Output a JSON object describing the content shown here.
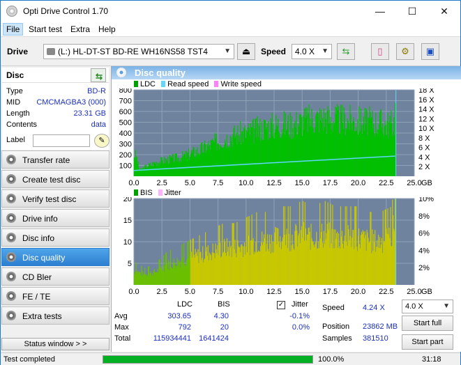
{
  "window": {
    "title": "Opti Drive Control 1.70",
    "minimize": "—",
    "maximize": "☐",
    "close": "✕"
  },
  "menu": [
    "File",
    "Start test",
    "Extra",
    "Help"
  ],
  "toolbar": {
    "drive_label": "Drive",
    "drive_value": "(L:)  HL-DT-ST BD-RE  WH16NS58 TST4",
    "speed_label": "Speed",
    "speed_value": "4.0 X",
    "icons": [
      "eject-icon",
      "refresh-icon",
      "eraser-icon",
      "settings-icon",
      "save-icon"
    ]
  },
  "disc": {
    "heading": "Disc",
    "rows": [
      {
        "k": "Type",
        "v": "BD-R"
      },
      {
        "k": "MID",
        "v": "CMCMAGBA3 (000)"
      },
      {
        "k": "Length",
        "v": "23.31 GB"
      },
      {
        "k": "Contents",
        "v": "data"
      }
    ],
    "label_text": "Label",
    "label_value": ""
  },
  "nav": [
    {
      "id": "transfer-rate",
      "label": "Transfer rate",
      "active": false
    },
    {
      "id": "create-test-disc",
      "label": "Create test disc",
      "active": false
    },
    {
      "id": "verify-test-disc",
      "label": "Verify test disc",
      "active": false
    },
    {
      "id": "drive-info",
      "label": "Drive info",
      "active": false
    },
    {
      "id": "disc-info",
      "label": "Disc info",
      "active": false
    },
    {
      "id": "disc-quality",
      "label": "Disc quality",
      "active": true
    },
    {
      "id": "cd-bler",
      "label": "CD Bler",
      "active": false
    },
    {
      "id": "fe-te",
      "label": "FE / TE",
      "active": false
    },
    {
      "id": "extra-tests",
      "label": "Extra tests",
      "active": false
    }
  ],
  "status_window_label": "Status window > >",
  "panel_title": "Disc quality",
  "legend_top": [
    "LDC",
    "Read speed",
    "Write speed"
  ],
  "legend_bottom": [
    "BIS",
    "Jitter"
  ],
  "colors": {
    "ldc": "#00c000",
    "read_speed": "#5fd7ff",
    "write_speed": "#ff7fff",
    "bis": "#c8c800",
    "jitter": "#ffb0ff",
    "grid": "#8fa2b8",
    "plot_bg": "#6f839e"
  },
  "chart_data": [
    {
      "type": "bar",
      "title": "",
      "xlabel": "GB",
      "x_ticks": [
        "0.0",
        "2.5",
        "5.0",
        "7.5",
        "10.0",
        "12.5",
        "15.0",
        "17.5",
        "20.0",
        "22.5",
        "25.0"
      ],
      "xlim": [
        0,
        25
      ],
      "y_left_ticks": [
        "100",
        "200",
        "300",
        "400",
        "500",
        "600",
        "700",
        "800"
      ],
      "ylim_left": [
        0,
        800
      ],
      "y_right_ticks": [
        "2 X",
        "4 X",
        "6 X",
        "8 X",
        "10 X",
        "12 X",
        "14 X",
        "16 X",
        "18 X"
      ],
      "ylim_right": [
        0,
        18
      ],
      "series": [
        {
          "name": "LDC",
          "x": [
            0.2,
            0.5,
            1,
            2,
            3,
            4,
            5,
            6,
            7,
            8,
            9,
            10,
            11,
            12,
            13,
            14,
            15,
            16,
            17,
            18,
            19,
            20,
            21,
            22,
            23,
            23.3
          ],
          "values": [
            250,
            70,
            110,
            170,
            200,
            220,
            270,
            320,
            390,
            450,
            500,
            520,
            560,
            600,
            620,
            620,
            660,
            690,
            700,
            680,
            670,
            660,
            650,
            640,
            620,
            680
          ]
        },
        {
          "name": "Read speed",
          "x": [
            0,
            23.3
          ],
          "values": [
            1.2,
            4.2
          ]
        }
      ]
    },
    {
      "type": "bar",
      "title": "",
      "xlabel": "GB",
      "x_ticks": [
        "0.0",
        "2.5",
        "5.0",
        "7.5",
        "10.0",
        "12.5",
        "15.0",
        "17.5",
        "20.0",
        "22.5",
        "25.0"
      ],
      "xlim": [
        0,
        25
      ],
      "y_left_ticks": [
        "5",
        "10",
        "15",
        "20"
      ],
      "ylim_left": [
        0,
        20
      ],
      "y_right_ticks": [
        "2%",
        "4%",
        "6%",
        "8%",
        "10%"
      ],
      "ylim_right": [
        0,
        10
      ],
      "series": [
        {
          "name": "BIS",
          "x": [
            0.2,
            1,
            2,
            3,
            4,
            5,
            6,
            7,
            8,
            9,
            10,
            11,
            12,
            13,
            14,
            15,
            16,
            17,
            18,
            19,
            20,
            21,
            22,
            23,
            23.3
          ],
          "values": [
            4,
            3,
            4,
            6,
            7,
            8,
            9,
            10,
            11,
            11,
            12,
            13,
            13,
            14,
            14,
            15,
            14,
            15,
            14,
            14,
            14,
            13,
            13,
            14,
            20
          ]
        }
      ]
    }
  ],
  "stats": {
    "headers": [
      "LDC",
      "BIS"
    ],
    "jitter_label": "Jitter",
    "jitter_checked": "✓",
    "rows": [
      {
        "label": "Avg",
        "ldc": "303.65",
        "bis": "4.30",
        "jitter": "-0.1%"
      },
      {
        "label": "Max",
        "ldc": "792",
        "bis": "20",
        "jitter": "0.0%"
      },
      {
        "label": "Total",
        "ldc": "115934441",
        "bis": "1641424",
        "jitter": ""
      }
    ],
    "speed_label": "Speed",
    "speed_value": "4.24 X",
    "position_label": "Position",
    "position_value": "23862 MB",
    "samples_label": "Samples",
    "samples_value": "381510",
    "speed_select": "4.0 X",
    "start_full": "Start full",
    "start_part": "Start part"
  },
  "status": {
    "text": "Test completed",
    "progress": 1.0,
    "progress_text": "100.0%",
    "time": "31:18"
  }
}
